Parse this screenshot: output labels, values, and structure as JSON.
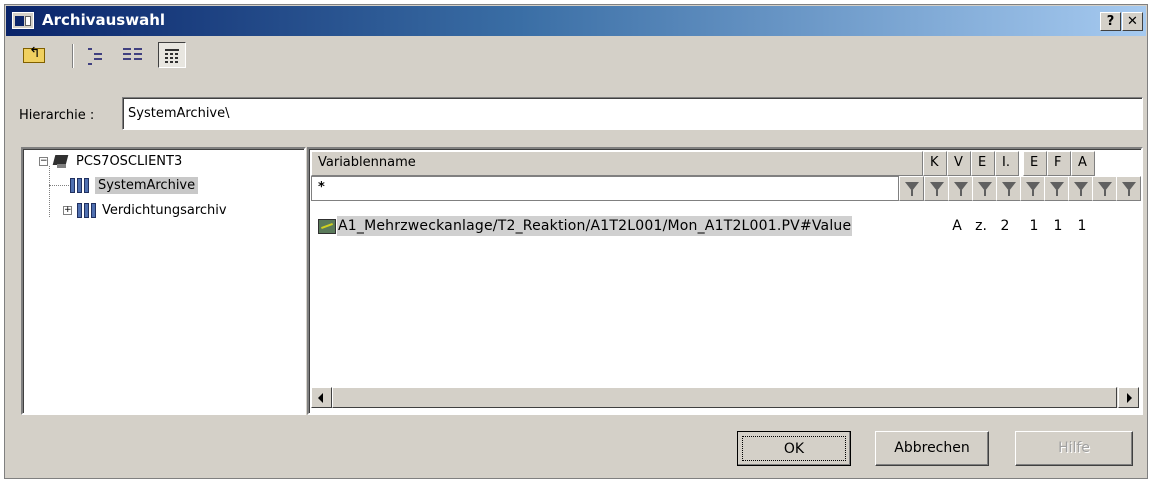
{
  "window": {
    "title": "Archivauswahl",
    "help_label": "?",
    "close_label": "✕"
  },
  "toolbar": {
    "icons": [
      "folder-up-icon",
      "tree-view-icon",
      "list-view-icon",
      "details-view-icon"
    ],
    "active": "details-view-icon"
  },
  "hierarchy": {
    "label": "Hierarchie :",
    "value": "SystemArchive\\"
  },
  "tree": {
    "root": "PCS7OSCLIENT3",
    "items": [
      {
        "label": "SystemArchive",
        "selected": true
      },
      {
        "label": "Verdichtungsarchiv",
        "expandable": true
      }
    ]
  },
  "grid": {
    "columns": [
      "Variablenname",
      "K",
      "V",
      "E",
      "I.",
      "E",
      "F",
      "A"
    ],
    "filter": "*",
    "rows": [
      {
        "name": "A1_Mehrzweckanlage/T2_Reaktion/A1T2L001/Mon_A1T2L001.PV#Value",
        "values": [
          "",
          "A",
          "z.",
          "2",
          "1",
          "1",
          "1"
        ]
      }
    ]
  },
  "buttons": {
    "ok": "OK",
    "cancel": "Abbrechen",
    "help": "Hilfe"
  }
}
